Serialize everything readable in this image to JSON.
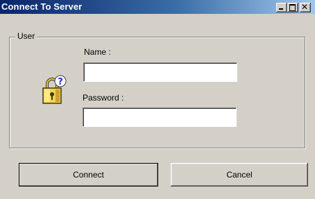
{
  "window": {
    "title": "Connect To Server",
    "controls": {
      "minimize": "minimize",
      "maximize": "maximize",
      "close": "close"
    }
  },
  "group": {
    "legend": "User"
  },
  "form": {
    "name_label": "Name :",
    "name_value": "",
    "password_label": "Password :",
    "password_value": ""
  },
  "buttons": {
    "connect": "Connect",
    "cancel": "Cancel"
  },
  "icons": {
    "user_icon": "lock-key-help-icon"
  },
  "colors": {
    "titlebar_start": "#0a246a",
    "titlebar_end": "#a6caf0",
    "face": "#d4d0c8",
    "lock_yellow": "#f5d34a",
    "help_blue": "#1d2fcf"
  }
}
